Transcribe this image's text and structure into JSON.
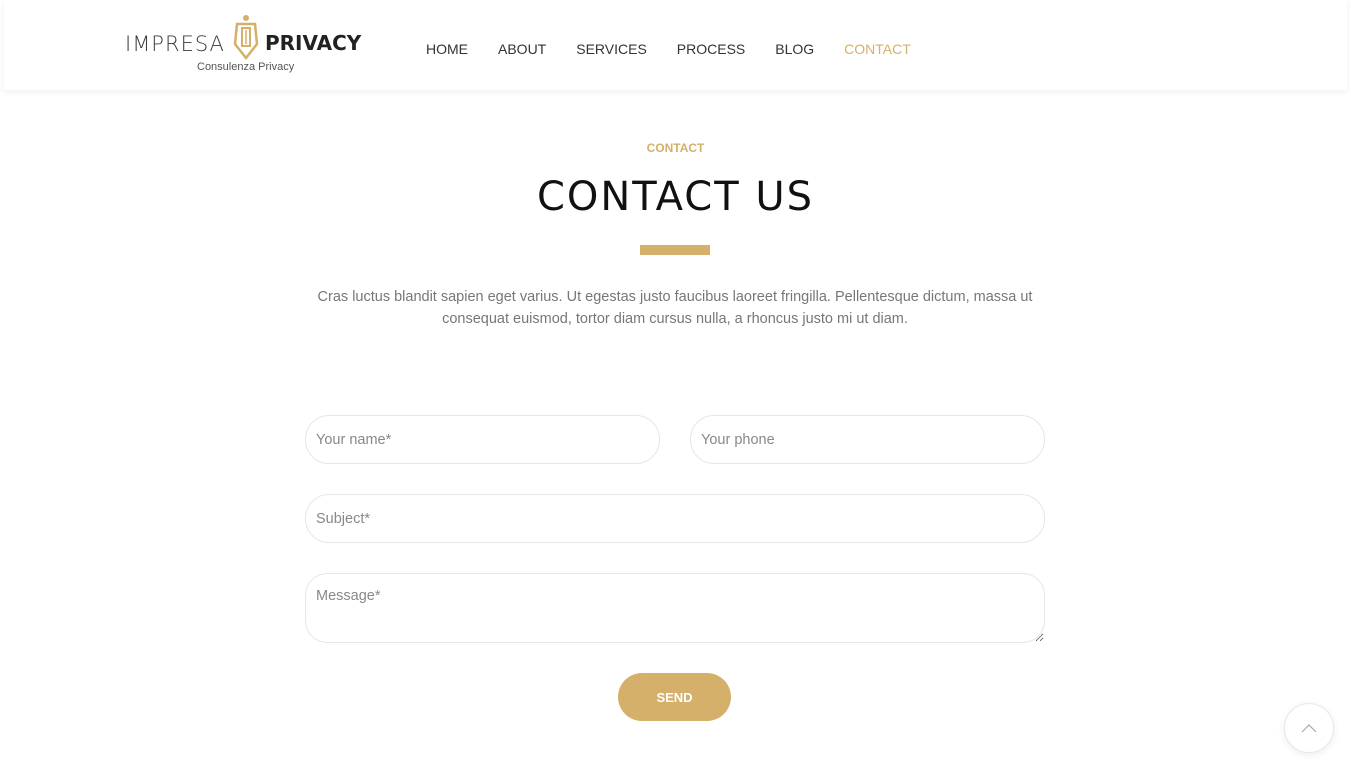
{
  "brand": {
    "name_left": "IMPRESA",
    "name_right": "PRIVACY",
    "tagline": "Consulenza Privacy",
    "accent_color": "#d4b06a"
  },
  "nav": {
    "items": [
      {
        "label": "HOME"
      },
      {
        "label": "ABOUT"
      },
      {
        "label": "SERVICES"
      },
      {
        "label": "PROCESS"
      },
      {
        "label": "BLOG"
      },
      {
        "label": "CONTACT",
        "active": true
      }
    ]
  },
  "section": {
    "tag": "CONTACT",
    "title": "CONTACT US",
    "description": "Cras luctus blandit sapien eget varius. Ut egestas justo faucibus laoreet fringilla. Pellentesque dictum, massa ut consequat euismod, tortor diam cursus nulla, a rhoncus justo mi ut diam."
  },
  "form": {
    "name_placeholder": "Your name*",
    "phone_placeholder": "Your phone",
    "subject_placeholder": "Subject*",
    "message_placeholder": "Message*",
    "send_label": "SEND"
  },
  "icons": {
    "scroll_top": "chevron-up-icon",
    "logo": "logo-icon"
  }
}
